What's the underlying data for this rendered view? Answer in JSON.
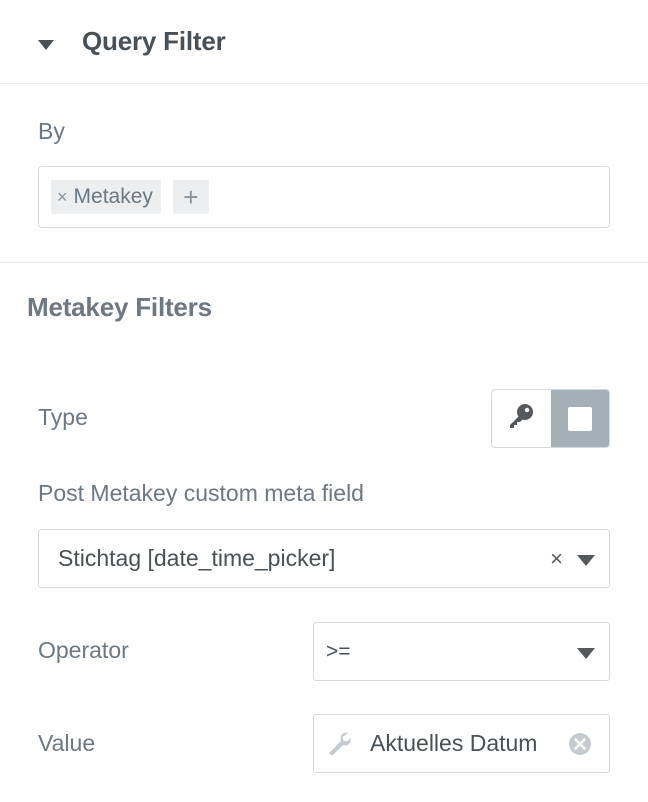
{
  "section": {
    "title": "Query Filter",
    "icon": "caret-down-icon"
  },
  "by": {
    "label": "By",
    "tags": [
      {
        "remove": "×",
        "label": "Metakey"
      }
    ],
    "add": "+"
  },
  "metakey": {
    "title": "Metakey Filters",
    "type": {
      "label": "Type",
      "options": [
        {
          "icon": "key-icon",
          "active": false
        },
        {
          "icon": "square-icon",
          "active": true
        }
      ]
    },
    "field": {
      "label": "Post Metakey custom meta field",
      "value": "Stichtag [date_time_picker]",
      "clear": "×"
    },
    "operator": {
      "label": "Operator",
      "value": ">="
    },
    "value": {
      "label": "Value",
      "text": "Aktuelles Datum",
      "icon": "wrench-icon"
    }
  },
  "colors": {
    "border": "#d5dadf",
    "active_toggle": "#a4afb7",
    "text": "#6d7882",
    "dark_text": "#495157"
  }
}
